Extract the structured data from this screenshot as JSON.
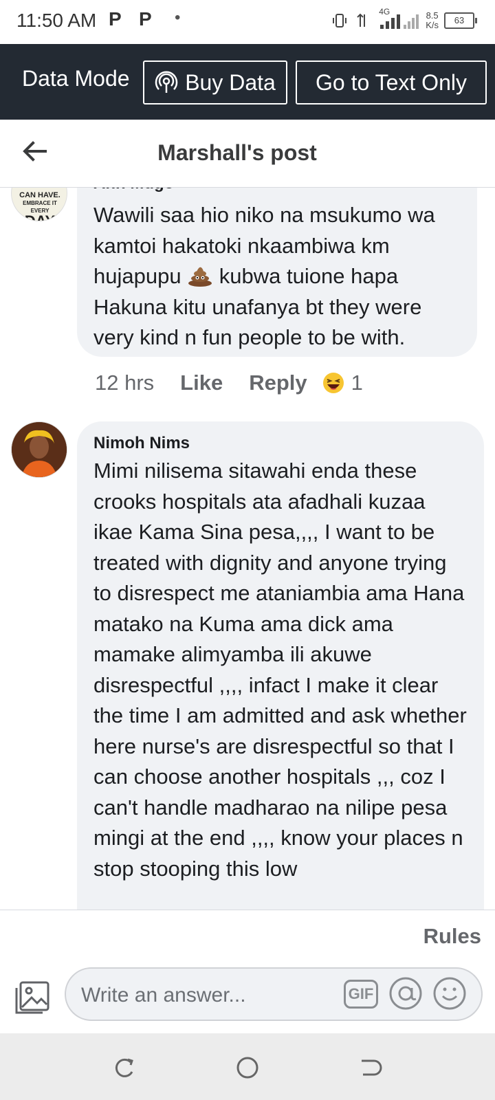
{
  "status_bar": {
    "time": "11:50 AM",
    "p1": "P",
    "p2": "P",
    "dot": "•",
    "net_top": "8.5",
    "net_bottom": "K/s",
    "battery": "63",
    "signal_label": "4G"
  },
  "data_mode": {
    "label": "Data Mode",
    "buy_label": "Buy Data",
    "text_only_label": "Go to Text Only"
  },
  "header": {
    "title": "Marshall's post"
  },
  "comments": [
    {
      "author": "Ann Mugo",
      "avatar_text_top": "CAN HAVE.",
      "avatar_text_mid": "EMBRACE IT EVERY",
      "avatar_text_big": "DAY",
      "text_before_emoji": "Wawili saa hio niko na msukumo wa kamtoi hakatoki nkaambiwa km hujapupu ",
      "text_after_emoji": " kubwa tuione hapa Hakuna kitu unafanya bt they were very kind n fun people to be with.",
      "time": "12 hrs",
      "like": "Like",
      "reply": "Reply",
      "reaction_count": "1"
    },
    {
      "author": "Nimoh Nims",
      "text": "Mimi nilisema sitawahi enda these crooks hospitals ata afadhali kuzaa ikae Kama Sina pesa,,,, I want to be treated with dignity and anyone trying to disrespect me ataniambia ama Hana matako na Kuma ama dick ama mamake alimyamba ili akuwe disrespectful ,,,, infact I make it clear the time I am admitted and ask whether here nurse's are disrespectful so that I can choose another hospitals ,,, coz I can't handle madharao na nilipe pesa mingi at the end ,,,, know your places n stop stooping this low"
    }
  ],
  "footer": {
    "rules": "Rules",
    "placeholder": "Write an answer...",
    "gif": "GIF"
  }
}
